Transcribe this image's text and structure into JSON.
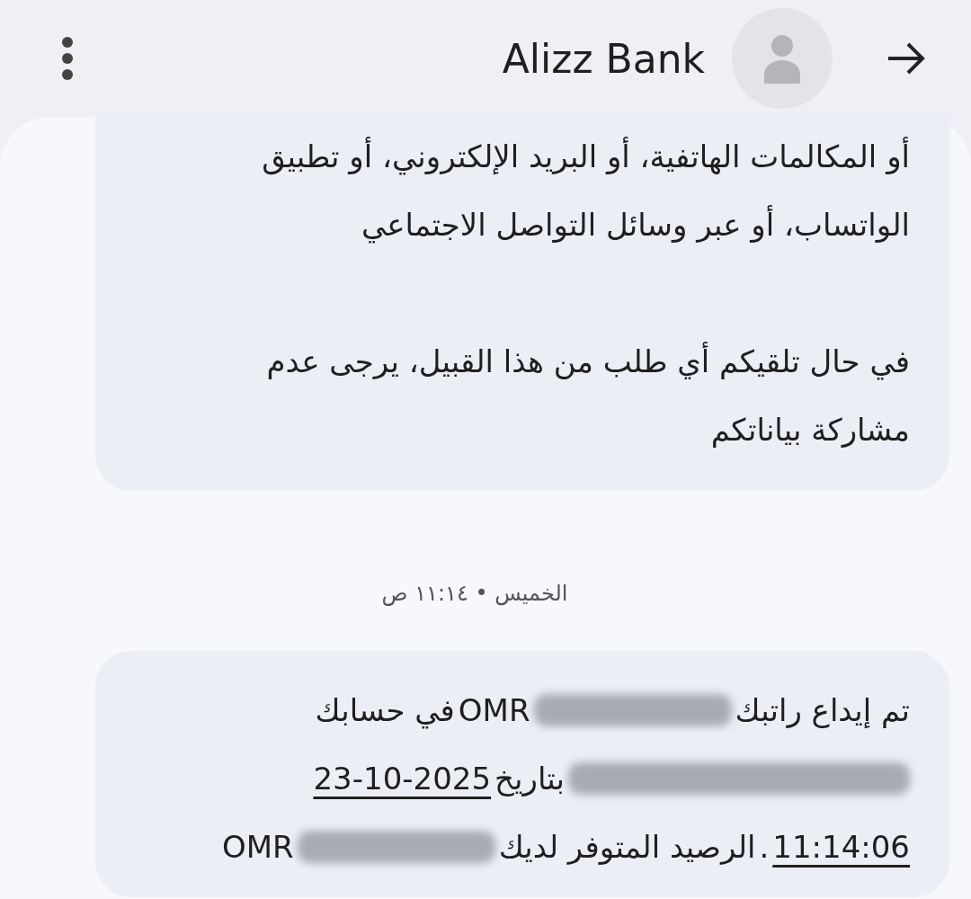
{
  "header": {
    "title": "Alizz Bank"
  },
  "messages": [
    {
      "kind": "bubble",
      "lines": [
        [
          {
            "kind": "text",
            "text": "أو المكالمات الهاتفية، أو البريد الإلكتروني، أو تطبيق"
          }
        ],
        [
          {
            "kind": "text",
            "text": "الواتساب، أو عبر وسائل التواصل الاجتماعي"
          }
        ],
        [
          {
            "kind": "blank"
          }
        ],
        [
          {
            "kind": "text",
            "text": "في حال تلقيكم أي طلب من هذا القبيل، يرجى عدم"
          }
        ],
        [
          {
            "kind": "text",
            "text": "مشاركة بياناتكم"
          }
        ]
      ]
    },
    {
      "kind": "timestamp",
      "text": "الخميس • ١١:١٤ ص"
    },
    {
      "kind": "bubble",
      "lines": [
        [
          {
            "kind": "text",
            "text": "تم إيداع راتبك"
          },
          {
            "kind": "redacted"
          },
          {
            "kind": "text",
            "text": "OMR"
          },
          {
            "kind": "text",
            "text": "في حسابك"
          }
        ],
        [
          {
            "kind": "redacted",
            "wide": true
          },
          {
            "kind": "text",
            "text": "بتاريخ"
          },
          {
            "kind": "link",
            "text": "23-10-2025"
          }
        ],
        [
          {
            "kind": "link",
            "text": "11:14:06"
          },
          {
            "kind": "text",
            "text": "."
          },
          {
            "kind": "text",
            "text": "الرصيد المتوفر لديك"
          },
          {
            "kind": "redacted"
          },
          {
            "kind": "text",
            "text": "OMR"
          }
        ]
      ]
    }
  ]
}
